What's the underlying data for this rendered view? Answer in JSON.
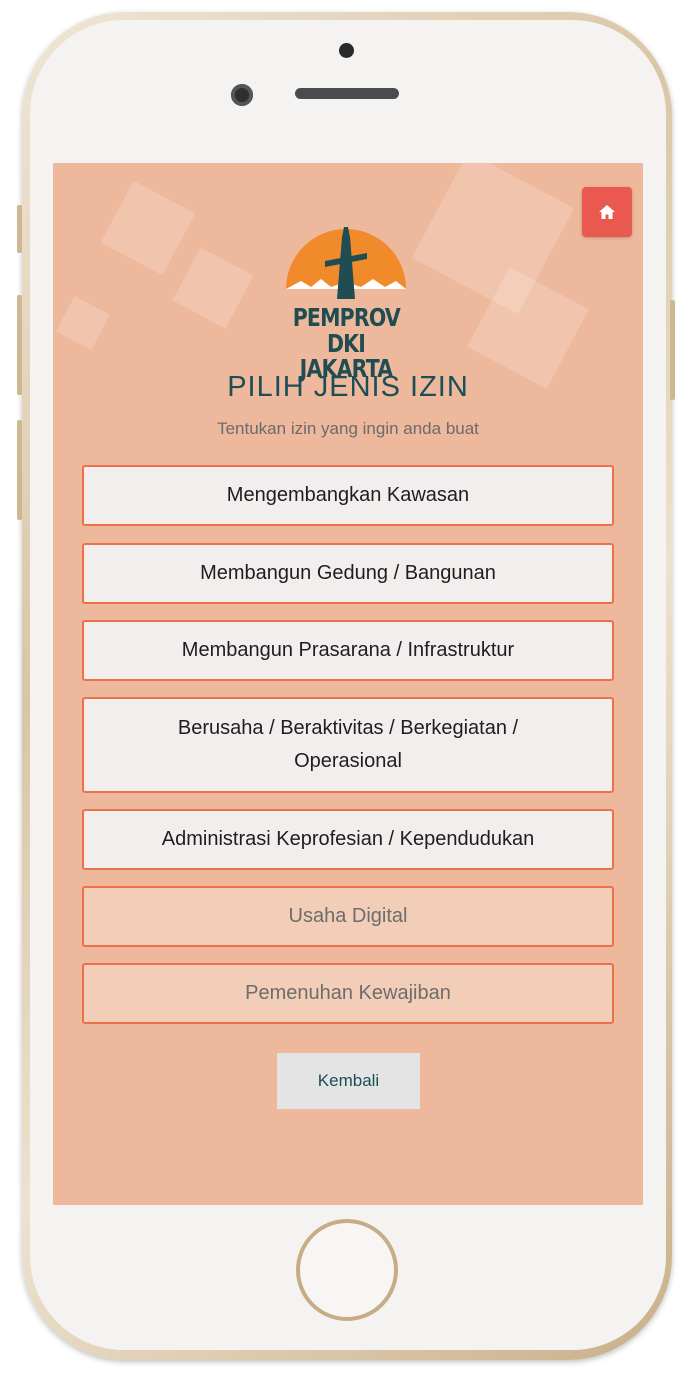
{
  "header": {
    "logo_line1": "PEMPROV",
    "logo_line2": "DKI JAKARTA",
    "title": "PILIH JENIS IZIN",
    "subtitle": "Tentukan izin yang ingin anda buat"
  },
  "home_button": {
    "icon": "home-icon"
  },
  "options": [
    {
      "label": "Mengembangkan Kawasan"
    },
    {
      "label": "Membangun Gedung / Bangunan"
    },
    {
      "label": "Membangun Prasarana / Infrastruktur"
    },
    {
      "label": "Berusaha / Beraktivitas / Berkegiatan / Operasional"
    },
    {
      "label": "Administrasi Keprofesian / Kependudukan"
    },
    {
      "label": "Usaha Digital"
    },
    {
      "label": "Pemenuhan Kewajiban"
    }
  ],
  "back_button": {
    "label": "Kembali"
  },
  "colors": {
    "background": "#edb89c",
    "accent": "#ee7049",
    "home_button": "#e9594f",
    "title": "#1d4e57",
    "logo_orange": "#f08a2a"
  }
}
